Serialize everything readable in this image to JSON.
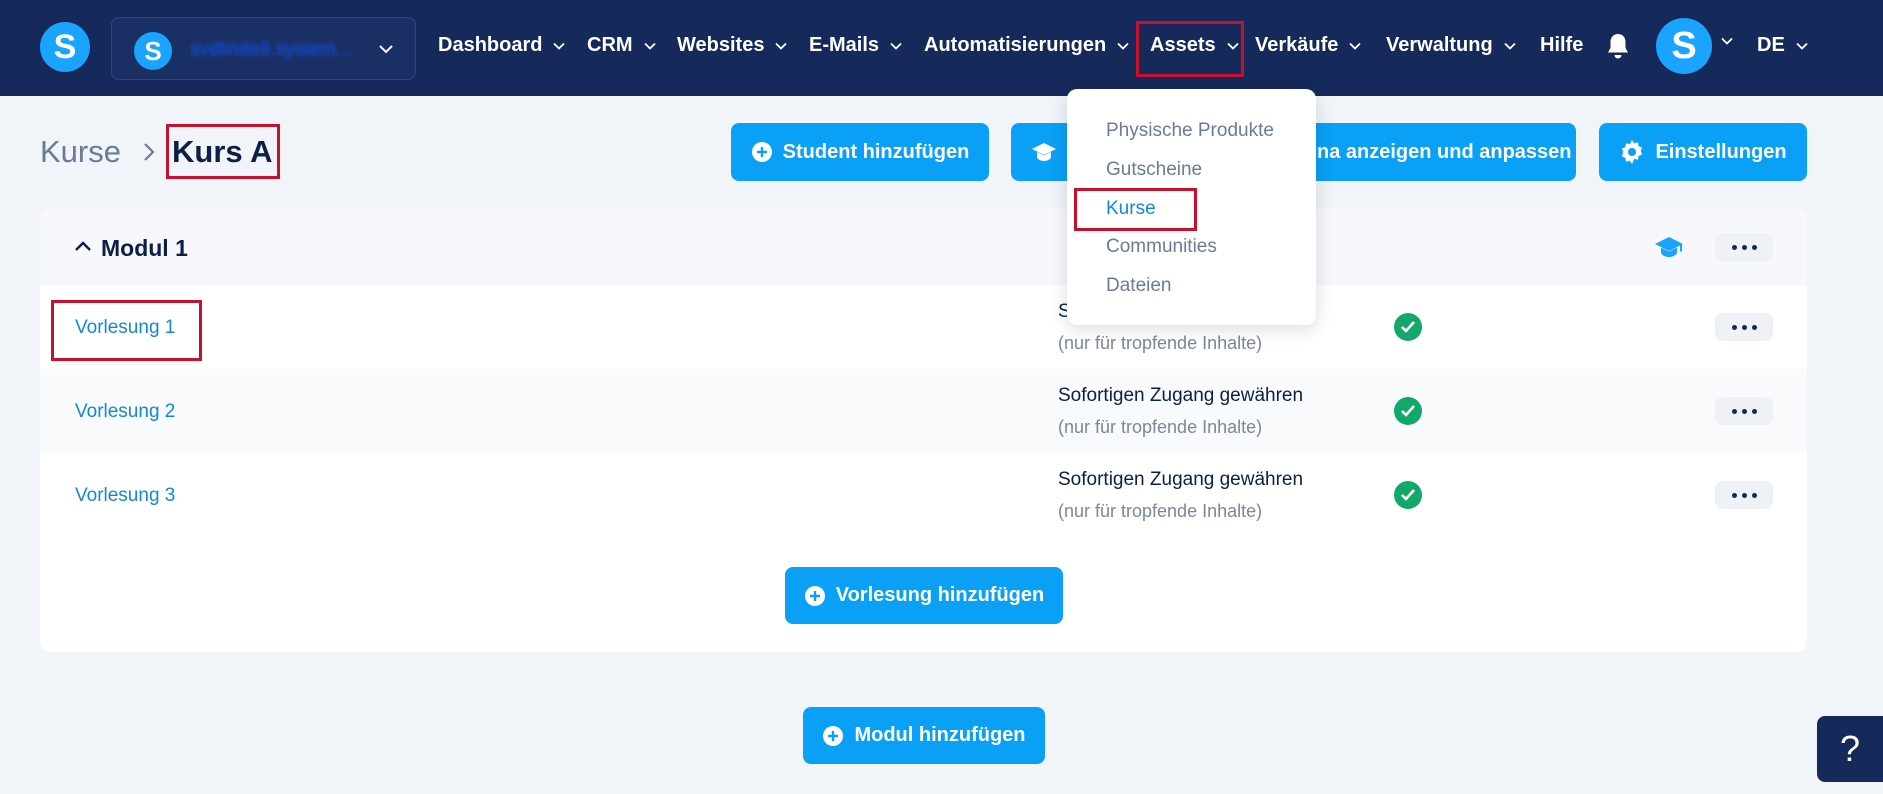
{
  "header": {
    "logo_letter": "S",
    "account": {
      "avatar_letter": "S",
      "name": "svdlinde6.system..."
    },
    "nav": [
      {
        "label": "Dashboard"
      },
      {
        "label": "CRM"
      },
      {
        "label": "Websites"
      },
      {
        "label": "E-Mails"
      },
      {
        "label": "Automatisierungen"
      },
      {
        "label": "Assets"
      },
      {
        "label": "Verkäufe"
      },
      {
        "label": "Verwaltung"
      },
      {
        "label": "Hilfe"
      }
    ],
    "user_avatar_letter": "S",
    "language": "DE"
  },
  "assets_menu": {
    "items": [
      {
        "label": "Physische Produkte"
      },
      {
        "label": "Gutscheine"
      },
      {
        "label": "Kurse"
      },
      {
        "label": "Communities"
      },
      {
        "label": "Dateien"
      }
    ]
  },
  "breadcrumb": {
    "root": "Kurse",
    "current": "Kurs A"
  },
  "toolbar": {
    "add_student": "Student hinzufügen",
    "preview_adjust": "na anzeigen und anpassen",
    "settings": "Einstellungen"
  },
  "module": {
    "title": "Modul 1",
    "lectures": [
      {
        "title": "Vorlesung 1",
        "access": "S",
        "access_note": "(nur für tropfende Inhalte)"
      },
      {
        "title": "Vorlesung 2",
        "access": "Sofortigen Zugang gewähren",
        "access_note": "(nur für tropfende Inhalte)"
      },
      {
        "title": "Vorlesung 3",
        "access": "Sofortigen Zugang gewähren",
        "access_note": "(nur für tropfende Inhalte)"
      }
    ],
    "add_lecture": "Vorlesung hinzufügen"
  },
  "add_module": "Modul hinzufügen",
  "help_label": "?",
  "colors": {
    "nav_bg": "#15295a",
    "primary": "#0aa0f5",
    "link": "#1487d8",
    "success": "#12a86a",
    "highlight": "#c8102e"
  }
}
